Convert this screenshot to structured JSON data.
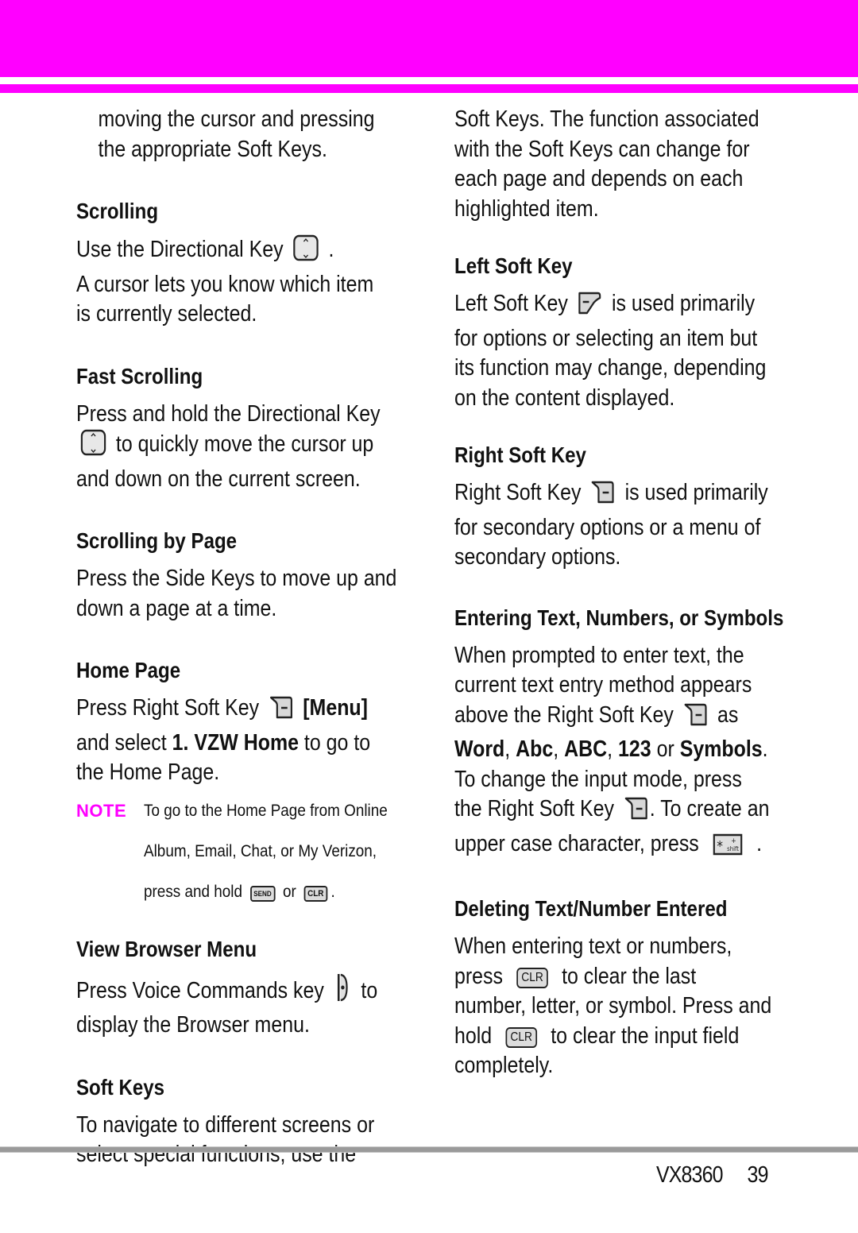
{
  "header": {
    "accent_color": "#ff00ff"
  },
  "left_column": {
    "intro": [
      "moving the cursor and pressing",
      "the appropriate Soft Keys."
    ],
    "scrolling": {
      "title": "Scrolling",
      "line1_pre": "Use the Directional Key",
      "line1_post": ".",
      "line2": "A cursor lets you know which item",
      "line3": "is currently selected."
    },
    "fast_scrolling": {
      "title": "Fast Scrolling",
      "line1": "Press and hold the Directional Key",
      "line2_post": "to quickly move the cursor up",
      "line3": "and down on the current screen."
    },
    "scrolling_by_page": {
      "title": "Scrolling by Page",
      "line1": "Press the Side Keys to move up and",
      "line2": "down a page at a time."
    },
    "home_page": {
      "title": "Home Page",
      "line1_pre": "Press Right Soft Key",
      "line1_bold": "[Menu]",
      "line2_pre": "and select ",
      "line2_bold": "1. VZW Home",
      "line2_post": " to go to",
      "line3": "the Home Page."
    },
    "note": {
      "label": "NOTE",
      "line1": "To go to the Home Page from Online",
      "line2": "Album, Email, Chat, or My Verizon,",
      "line3_pre": "press and hold",
      "key1": "SEND",
      "or": "or",
      "key2": "CLR",
      "line3_post": "."
    },
    "view_browser_menu": {
      "title": "View Browser Menu",
      "line1_pre": "Press Voice Commands key",
      "line1_post": "to",
      "line2": "display the Browser menu."
    },
    "soft_keys": {
      "title": "Soft Keys",
      "line1": "To navigate to different screens or",
      "line2": "select special functions, use the"
    }
  },
  "right_column": {
    "soft_keys_cont": [
      "Soft Keys. The function associated",
      "with the Soft Keys can change for",
      "each page and depends on each",
      "highlighted item."
    ],
    "left_soft_key": {
      "title": "Left Soft Key",
      "line1_pre": "Left Soft Key",
      "line1_post": "is used primarily",
      "line2": "for options or selecting an item but",
      "line3": "its function may change, depending",
      "line4": "on the content displayed."
    },
    "right_soft_key": {
      "title": "Right Soft Key",
      "line1_pre": "Right Soft Key",
      "line1_post": "is used primarily",
      "line2": "for secondary options or a menu of",
      "line3": "secondary options."
    },
    "entering_text": {
      "title": "Entering Text, Numbers, or Symbols",
      "line1": "When prompted to enter text, the",
      "line2": "current text entry method appears",
      "line3_pre": "above the Right Soft Key",
      "line3_post": "as",
      "modes": [
        "Word",
        "Abc",
        "ABC",
        "123"
      ],
      "sep": ", ",
      "or": " or ",
      "last_mode": "Symbols",
      "line4_end": ".",
      "line5": "To change the input mode, press",
      "line6_pre": "the Right Soft Key",
      "line6_post": ". To create an",
      "line7_pre": "upper case character, press",
      "line7_post": ".",
      "shift_key_label": "shift"
    },
    "deleting_text": {
      "title": "Deleting Text/Number Entered",
      "line1": "When entering text or numbers,",
      "line2_pre": "press",
      "key": "CLR",
      "line2_post": "to clear the last",
      "line3": "number, letter, or symbol. Press and",
      "line4_pre": "hold",
      "line4_post": "to clear the input field",
      "line5": "completely."
    }
  },
  "footer": {
    "model": "VX8360",
    "page": "39"
  }
}
